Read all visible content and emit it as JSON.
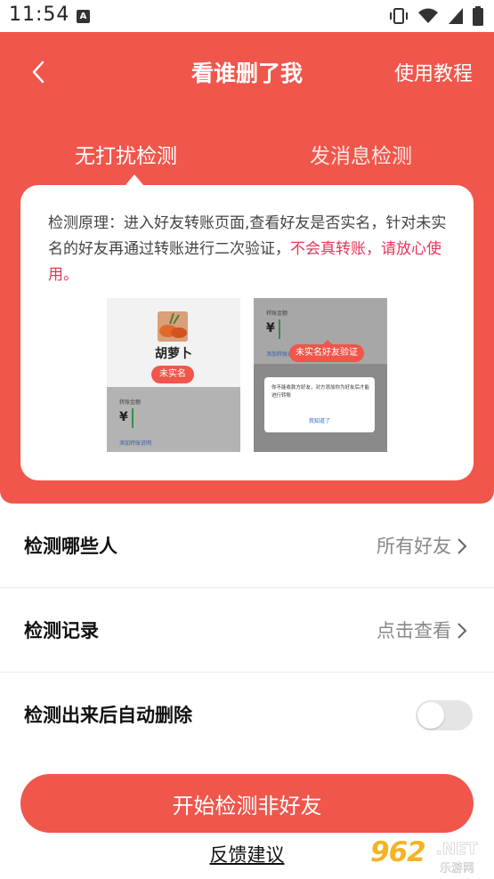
{
  "status_bar": {
    "time": "11:54",
    "a_badge": "A"
  },
  "header": {
    "title": "看谁删了我",
    "tutorial": "使用教程"
  },
  "tabs": [
    {
      "label": "无打扰检测",
      "active": true
    },
    {
      "label": "发消息检测",
      "active": false
    }
  ],
  "card": {
    "principle_text": "检测原理：进入好友转账页面,查看好友是否实名，针对未实名的好友再通过转账进行二次验证，",
    "principle_highlight": "不会真转账，请放心使用。",
    "illustration_left": {
      "name": "胡萝卜",
      "badge": "未实名",
      "amount_label": "转账金额",
      "yen": "¥",
      "note": "添加转账说明"
    },
    "illustration_right": {
      "amount_label": "转账金额",
      "yen": "¥",
      "note": "添加转账说明",
      "badge": "未实名好友验证",
      "dialog_text": "你不能收款方好友，对方添加你为好友后才能进行转账",
      "dialog_button": "我知道了"
    }
  },
  "rows": [
    {
      "label": "检测哪些人",
      "value": "所有好友"
    },
    {
      "label": "检测记录",
      "value": "点击查看"
    },
    {
      "label": "检测出来后自动删除",
      "toggle_on": false
    }
  ],
  "start_button": "开始检测非好友",
  "feedback": "反馈建议",
  "watermark": {
    "number": "962",
    "net": ".NET",
    "site": "乐游网"
  },
  "colors": {
    "primary": "#f0564b",
    "highlight": "#e8345a"
  }
}
